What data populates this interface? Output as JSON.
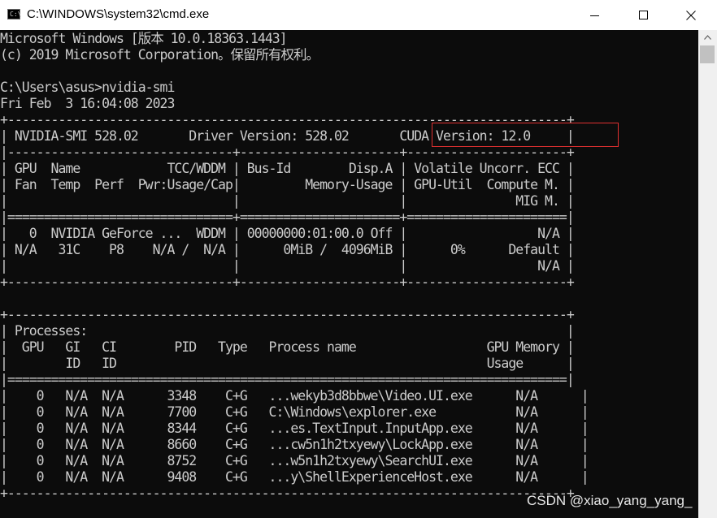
{
  "window": {
    "title": "C:\\WINDOWS\\system32\\cmd.exe",
    "icon_label": "C:\\",
    "buttons": [
      "minimize-icon",
      "maximize-icon",
      "close-icon"
    ]
  },
  "console": {
    "lines": [
      "Microsoft Windows [版本 10.0.18363.1443]",
      "(c) 2019 Microsoft Corporation。保留所有权利。",
      "",
      "C:\\Users\\asus>nvidia-smi",
      "Fri Feb  3 16:04:08 2023",
      "+-----------------------------------------------------------------------------+",
      "| NVIDIA-SMI 528.02       Driver Version: 528.02       CUDA Version: 12.0     |",
      "|-------------------------------+----------------------+----------------------+",
      "| GPU  Name            TCC/WDDM | Bus-Id        Disp.A | Volatile Uncorr. ECC |",
      "| Fan  Temp  Perf  Pwr:Usage/Cap|         Memory-Usage | GPU-Util  Compute M. |",
      "|                               |                      |               MIG M. |",
      "|===============================+======================+======================|",
      "|   0  NVIDIA GeForce ...  WDDM | 00000000:01:00.0 Off |                  N/A |",
      "| N/A   31C    P8    N/A /  N/A |      0MiB /  4096MiB |      0%      Default |",
      "|                               |                      |                  N/A |",
      "+-------------------------------+----------------------+----------------------+",
      "",
      "+-----------------------------------------------------------------------------+",
      "| Processes:                                                                  |",
      "|  GPU   GI   CI        PID   Type   Process name                  GPU Memory |",
      "|        ID   ID                                                   Usage      |",
      "|=============================================================================|",
      "|    0   N/A  N/A      3348    C+G   ...wekyb3d8bbwe\\Video.UI.exe      N/A      |",
      "|    0   N/A  N/A      7700    C+G   C:\\Windows\\explorer.exe           N/A      |",
      "|    0   N/A  N/A      8344    C+G   ...es.TextInput.InputApp.exe      N/A      |",
      "|    0   N/A  N/A      8660    C+G   ...cw5n1h2txyewy\\LockApp.exe      N/A      |",
      "|    0   N/A  N/A      8752    C+G   ...w5n1h2txyewy\\SearchUI.exe      N/A      |",
      "|    0   N/A  N/A      9408    C+G   ...y\\ShellExperienceHost.exe      N/A      |",
      "+-----------------------------------------------------------------------------+"
    ]
  },
  "annotation": {
    "highlight_color": "#e03030"
  },
  "watermark": "CSDN @xiao_yang_yang_",
  "colors": {
    "console_bg": "#0c0c0c",
    "console_text": "#cccccc",
    "titlebar_bg": "#ffffff"
  }
}
